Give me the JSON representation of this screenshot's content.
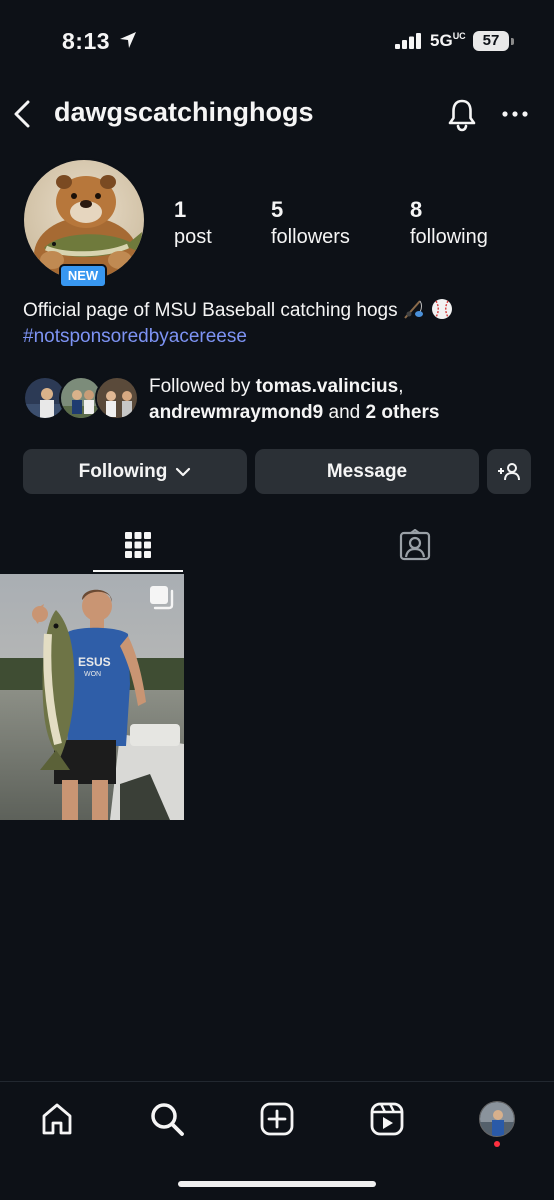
{
  "status_bar": {
    "time": "8:13",
    "network": "5G",
    "network_suffix": "UC",
    "battery": "57"
  },
  "header": {
    "username": "dawgscatchinghogs"
  },
  "profile": {
    "badge": "NEW",
    "stats": {
      "posts_count": "1",
      "posts_label": "post",
      "followers_count": "5",
      "followers_label": "followers",
      "following_count": "8",
      "following_label": "following"
    },
    "bio_text": "Official page of MSU Baseball catching hogs",
    "bio_hashtag": "#notsponsoredbyacereese",
    "followed_by": {
      "prefix": "Followed by",
      "user1": "tomas.valincius",
      "user2": "andrewmraymond9",
      "joiner": "and",
      "others": "2 others"
    }
  },
  "actions": {
    "following_label": "Following",
    "message_label": "Message"
  },
  "colors": {
    "background": "#0d1117",
    "button": "#2b3036",
    "hashtag": "#7d93f3",
    "badge": "#3897f0",
    "notification_dot": "#ff3040"
  },
  "icons": [
    "location-arrow-icon",
    "signal-icon",
    "back-icon",
    "bell-icon",
    "more-icon",
    "chevron-down-icon",
    "add-person-icon",
    "grid-icon",
    "tagged-icon",
    "multiple-posts-icon",
    "home-icon",
    "search-icon",
    "create-icon",
    "reels-icon"
  ]
}
